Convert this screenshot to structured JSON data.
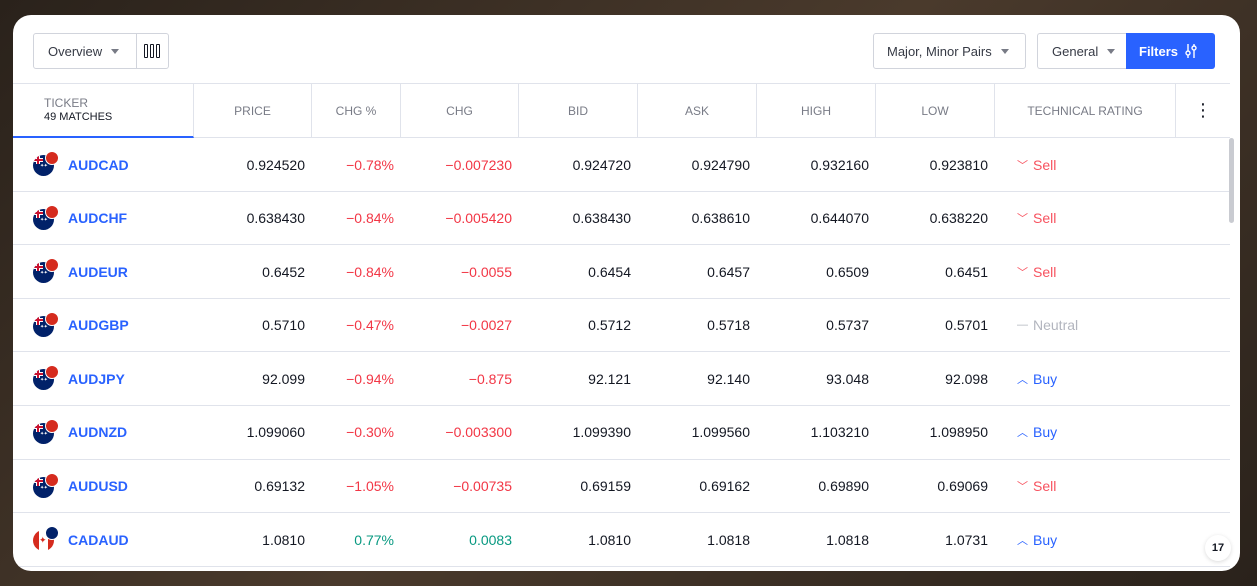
{
  "toolbar": {
    "overview_label": "Overview",
    "pairs_label": "Major, Minor Pairs",
    "general_label": "General",
    "filters_label": "Filters"
  },
  "header": {
    "ticker": "TICKER",
    "matches": "49 MATCHES",
    "columns": [
      "PRICE",
      "CHG %",
      "CHG",
      "BID",
      "ASK",
      "HIGH",
      "LOW",
      "TECHNICAL RATING"
    ],
    "more_label": "⋮"
  },
  "rows": [
    {
      "symbol": "AUDCAD",
      "price": "0.924520",
      "chg_pct": "−0.78%",
      "chg": "−0.007230",
      "bid": "0.924720",
      "ask": "0.924790",
      "high": "0.932160",
      "low": "0.923810",
      "rating": "Sell"
    },
    {
      "symbol": "AUDCHF",
      "price": "0.638430",
      "chg_pct": "−0.84%",
      "chg": "−0.005420",
      "bid": "0.638430",
      "ask": "0.638610",
      "high": "0.644070",
      "low": "0.638220",
      "rating": "Sell"
    },
    {
      "symbol": "AUDEUR",
      "price": "0.6452",
      "chg_pct": "−0.84%",
      "chg": "−0.0055",
      "bid": "0.6454",
      "ask": "0.6457",
      "high": "0.6509",
      "low": "0.6451",
      "rating": "Sell"
    },
    {
      "symbol": "AUDGBP",
      "price": "0.5710",
      "chg_pct": "−0.47%",
      "chg": "−0.0027",
      "bid": "0.5712",
      "ask": "0.5718",
      "high": "0.5737",
      "low": "0.5701",
      "rating": "Neutral"
    },
    {
      "symbol": "AUDJPY",
      "price": "92.099",
      "chg_pct": "−0.94%",
      "chg": "−0.875",
      "bid": "92.121",
      "ask": "92.140",
      "high": "93.048",
      "low": "92.098",
      "rating": "Buy"
    },
    {
      "symbol": "AUDNZD",
      "price": "1.099060",
      "chg_pct": "−0.30%",
      "chg": "−0.003300",
      "bid": "1.099390",
      "ask": "1.099560",
      "high": "1.103210",
      "low": "1.098950",
      "rating": "Buy"
    },
    {
      "symbol": "AUDUSD",
      "price": "0.69132",
      "chg_pct": "−1.05%",
      "chg": "−0.00735",
      "bid": "0.69159",
      "ask": "0.69162",
      "high": "0.69890",
      "low": "0.69069",
      "rating": "Sell"
    },
    {
      "symbol": "CADAUD",
      "price": "1.0810",
      "chg_pct": "0.77%",
      "chg": "0.0083",
      "bid": "1.0810",
      "ask": "1.0818",
      "high": "1.0818",
      "low": "1.0731",
      "rating": "Buy"
    }
  ],
  "rating_icons": {
    "Sell": "﹀",
    "Buy": "︿",
    "Neutral": "—"
  },
  "colors": {
    "accent": "#2962ff",
    "negative": "#f23645",
    "positive": "#089981",
    "neutral": "#b2b5be"
  },
  "logo_text": "17"
}
